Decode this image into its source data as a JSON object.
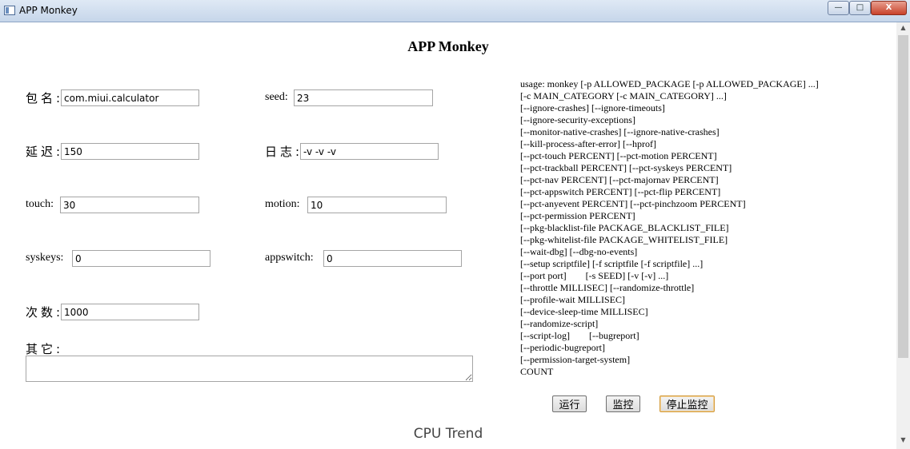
{
  "window": {
    "title": "APP Monkey",
    "min": "—",
    "max": "□",
    "close": "X"
  },
  "page": {
    "heading": "APP Monkey"
  },
  "form": {
    "package": {
      "label": "包名:",
      "value": "com.miui.calculator"
    },
    "seed": {
      "label": "seed:",
      "value": "23"
    },
    "delay": {
      "label": "延迟:",
      "value": "150"
    },
    "log": {
      "label": "日志:",
      "value": "-v -v -v"
    },
    "touch": {
      "label": "touch:",
      "value": "30"
    },
    "motion": {
      "label": "motion:",
      "value": "10"
    },
    "syskeys": {
      "label": "syskeys:",
      "value": "0"
    },
    "appswitch": {
      "label": "appswitch:",
      "value": "0"
    },
    "count": {
      "label": "次数:",
      "value": "1000"
    },
    "other": {
      "label": "其它:",
      "value": ""
    }
  },
  "usage_text": "usage: monkey [-p ALLOWED_PACKAGE [-p ALLOWED_PACKAGE] ...]\n[-c MAIN_CATEGORY [-c MAIN_CATEGORY] ...]\n[--ignore-crashes] [--ignore-timeouts]\n[--ignore-security-exceptions]\n[--monitor-native-crashes] [--ignore-native-crashes]\n[--kill-process-after-error] [--hprof]\n[--pct-touch PERCENT] [--pct-motion PERCENT]\n[--pct-trackball PERCENT] [--pct-syskeys PERCENT]\n[--pct-nav PERCENT] [--pct-majornav PERCENT]\n[--pct-appswitch PERCENT] [--pct-flip PERCENT]\n[--pct-anyevent PERCENT] [--pct-pinchzoom PERCENT]\n[--pct-permission PERCENT]\n[--pkg-blacklist-file PACKAGE_BLACKLIST_FILE]\n[--pkg-whitelist-file PACKAGE_WHITELIST_FILE]\n[--wait-dbg] [--dbg-no-events]\n[--setup scriptfile] [-f scriptfile [-f scriptfile] ...]\n[--port port]        [-s SEED] [-v [-v] ...]\n[--throttle MILLISEC] [--randomize-throttle]\n[--profile-wait MILLISEC]\n[--device-sleep-time MILLISEC]\n[--randomize-script]\n[--script-log]        [--bugreport]\n[--periodic-bugreport]\n[--permission-target-system]\nCOUNT",
  "buttons": {
    "run": "运行",
    "monitor": "监控",
    "stop_monitor": "停止监控"
  },
  "chart": {
    "title": "CPU Trend"
  },
  "icons": {
    "app": "app-window-icon",
    "scroll_up": "▲",
    "scroll_down": "▼"
  }
}
